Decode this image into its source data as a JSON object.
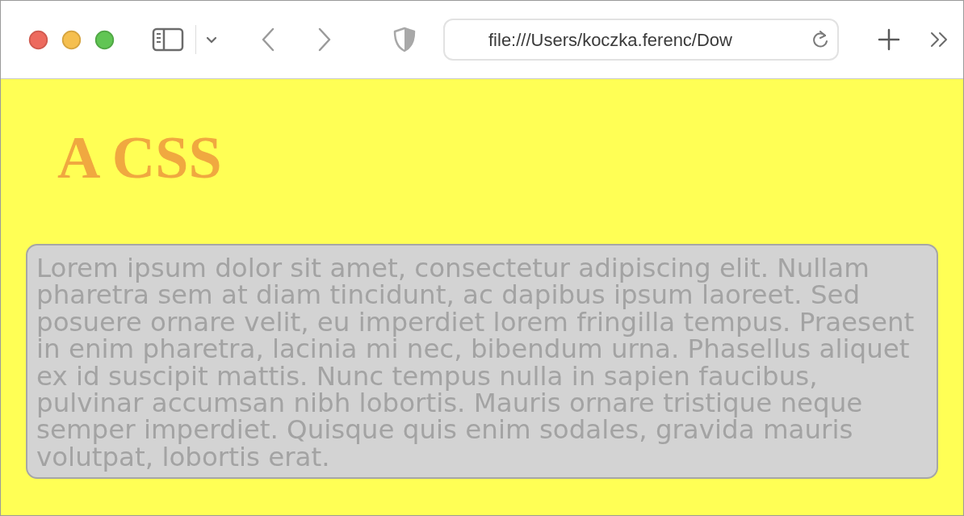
{
  "toolbar": {
    "address": "file:///Users/koczka.ferenc/Dow"
  },
  "page": {
    "heading": "A CSS",
    "paragraph": "Lorem ipsum dolor sit amet, consectetur adipiscing elit. Nullam pharetra sem at diam tincidunt, ac dapibus ipsum laoreet. Sed posuere ornare velit, eu imperdiet lorem fringilla tempus. Praesent in enim pharetra, lacinia mi nec, bibendum urna. Phasellus aliquet ex id suscipit mattis. Nunc tempus nulla in sapien faucibus, pulvinar accumsan nibh lobortis. Mauris ornare tristique neque semper imperdiet. Quisque quis enim sodales, gravida mauris volutpat, lobortis erat."
  }
}
